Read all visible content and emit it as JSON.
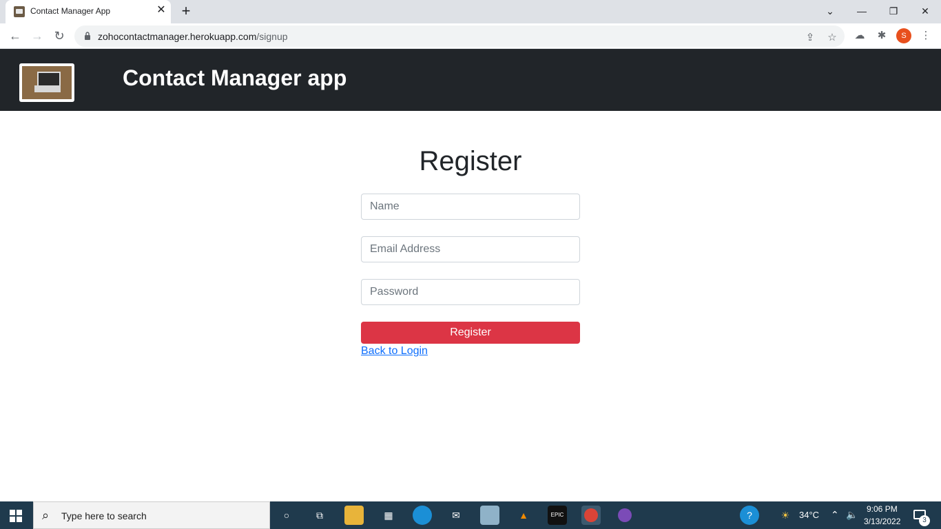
{
  "browser": {
    "tab_title": "Contact Manager App",
    "tab_close": "✕",
    "new_tab": "+",
    "url_host": "zohocontactmanager.herokuapp.com",
    "url_path": "/signup",
    "profile_initial": "S",
    "window_controls": [
      "⌄",
      "—",
      "❐",
      "✕"
    ]
  },
  "header": {
    "title": "Contact Manager app"
  },
  "form": {
    "heading": "Register",
    "name_placeholder": "Name",
    "email_placeholder": "Email Address",
    "password_placeholder": "Password",
    "submit_label": "Register",
    "back_link": "Back to Login"
  },
  "taskbar": {
    "search_placeholder": "Type here to search",
    "weather": "34°C",
    "time": "9:06 PM",
    "date": "3/13/2022",
    "notification_count": "3"
  }
}
